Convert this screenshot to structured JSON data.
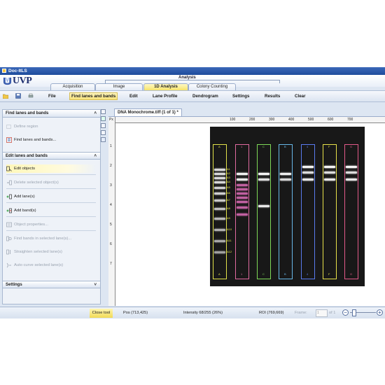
{
  "window": {
    "title": "Doc-ItLS"
  },
  "logo": {
    "text": "UVP"
  },
  "mode_group": {
    "label": "Analysis"
  },
  "mode_tabs": [
    {
      "label": "Acquisition",
      "active": false
    },
    {
      "label": "Image",
      "active": false
    },
    {
      "label": "1D Analysis",
      "active": true
    },
    {
      "label": "Colony Counting",
      "active": false
    }
  ],
  "menu": {
    "items": [
      "File",
      "Find lanes and bands",
      "Edit",
      "Lane Profile",
      "Dendrogram",
      "Settings",
      "Results",
      "Clear"
    ],
    "active": "Find lanes and bands"
  },
  "toolbar_icons": [
    "open-folder-icon",
    "save-icon",
    "print-icon"
  ],
  "side_panel": {
    "find_section": {
      "title": "Find lanes and bands",
      "chevron": "˄",
      "items": [
        {
          "label": "Define region",
          "enabled": false,
          "icon": "define-region-icon"
        },
        {
          "label": "Find lanes and bands...",
          "enabled": true,
          "icon": "find-lanes-icon"
        }
      ]
    },
    "edit_section": {
      "title": "Edit lanes and bands",
      "chevron": "˄",
      "items": [
        {
          "label": "Edit objects",
          "enabled": true,
          "highlighted": true,
          "icon": "edit-objects-icon"
        },
        {
          "label": "Delete selected object(s)",
          "enabled": false,
          "icon": "delete-icon"
        },
        {
          "label": "Add lane(s)",
          "enabled": true,
          "icon": "add-lane-icon"
        },
        {
          "label": "Add band(s)",
          "enabled": true,
          "icon": "add-band-icon"
        },
        {
          "label": "Object properties...",
          "enabled": false,
          "icon": "properties-icon"
        },
        {
          "label": "Find bands in selected lane(s)...",
          "enabled": false,
          "icon": "find-bands-icon"
        },
        {
          "label": "Straighten selected lane(s)",
          "enabled": false,
          "icon": "straighten-icon"
        },
        {
          "label": "Auto curve selected lane(s)",
          "enabled": false,
          "icon": "auto-curve-icon"
        }
      ]
    },
    "settings_section": {
      "title": "Settings",
      "chevron": "˅"
    }
  },
  "document": {
    "tab_label": "DNA Monochrome.tiff (1 of 1) *",
    "ruler_h": [
      "100",
      "200",
      "300",
      "400",
      "500",
      "600",
      "700"
    ],
    "ruler_v": [
      "1",
      "2",
      "3",
      "4",
      "5",
      "6",
      "7"
    ],
    "ruler_corner": "Px"
  },
  "gel": {
    "lanes": [
      {
        "label": "A",
        "color": "#e2e24a"
      },
      {
        "label": "1",
        "color": "#e06aa0"
      },
      {
        "label": "C",
        "color": "#7ed957"
      },
      {
        "label": "B",
        "color": "#68b8e8"
      },
      {
        "label": "4",
        "color": "#5a7cf0"
      },
      {
        "label": "F",
        "color": "#e8e24a"
      },
      {
        "label": "G",
        "color": "#e25a8a"
      }
    ],
    "marker_labels": [
      "A1",
      "A2",
      "A3",
      "A4",
      "A5",
      "A6",
      "A7",
      "A8",
      "A9",
      "A10",
      "A11",
      "A12"
    ]
  },
  "status": {
    "close_tool": "Close tool",
    "pos": "Pos (713,425)",
    "intensity": "Intensity 68/255 (26%)",
    "roi": "ROI (769,669)",
    "frame_label": "Frame:",
    "frame_value": "1",
    "of_total": "of 1",
    "zoom_out": "−",
    "zoom_in": "+"
  }
}
